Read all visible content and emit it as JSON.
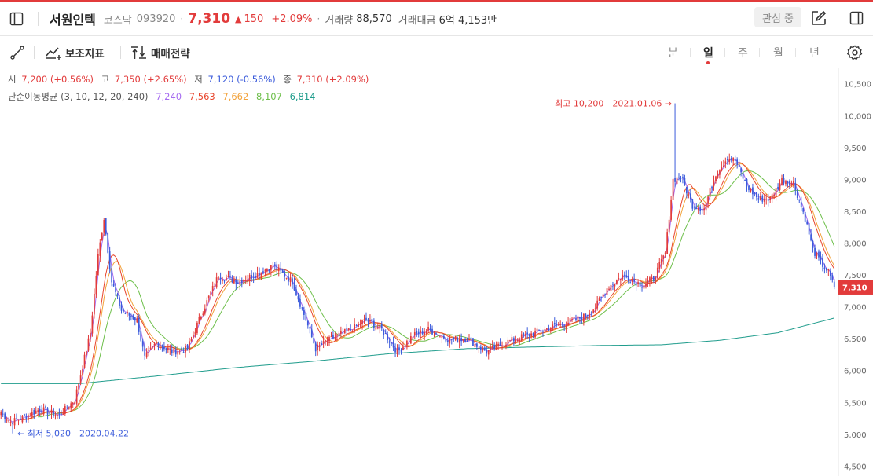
{
  "header": {
    "name": "서원인텍",
    "market": "코스닥",
    "code": "093920",
    "price": "7,310",
    "change_arrow": "▲",
    "change": "150",
    "change_pct": "+2.09%",
    "volume_label": "거래량",
    "volume": "88,570",
    "amount_label": "거래대금",
    "amount": "6억 4,153만",
    "favorite": "관심 중"
  },
  "toolbar": {
    "indicator": "보조지표",
    "strategy": "매매전략",
    "periods": [
      "분",
      "일",
      "주",
      "월",
      "년"
    ],
    "active_period": 1
  },
  "ohlc_bar": {
    "open_label": "시",
    "open": "7,200 (+0.56%)",
    "high_label": "고",
    "high": "7,350 (+2.65%)",
    "low_label": "저",
    "low": "7,120 (-0.56%)",
    "close_label": "종",
    "close": "7,310 (+2.09%)"
  },
  "ma_bar": {
    "label": "단순이동평균 (3, 10, 12, 20, 240)",
    "values": [
      "7,240",
      "7,563",
      "7,662",
      "8,107",
      "6,814"
    ]
  },
  "chart_data": {
    "type": "candlestick",
    "ylim": [
      4400,
      10700
    ],
    "yticks": [
      4500,
      5000,
      5500,
      6000,
      6500,
      7000,
      7500,
      8000,
      8500,
      9000,
      9500,
      10000,
      10500
    ],
    "ytick_labels": [
      "4,500",
      "5,000",
      "5,500",
      "6,000",
      "6,500",
      "7,000",
      "7,500",
      "8,000",
      "8,500",
      "9,000",
      "9,500",
      "10,000",
      "10,500"
    ],
    "last_price": 7310,
    "last_price_label": "7,310",
    "high_annotation": "최고 10,200 - 2021.01.06",
    "high_annotation_arrow": "→",
    "low_annotation_arrow": "←",
    "low_annotation": "최저 5,020 - 2020.04.22",
    "high_value": 10200,
    "low_value": 5020,
    "colors": {
      "up": "#e23b3b",
      "down": "#3b5bdb",
      "ma3": "#a66cf0",
      "ma10": "#e8452c",
      "ma12": "#f2a23a",
      "ma20": "#6dbf4a",
      "ma240": "#1f9c8c"
    },
    "anchors": [
      [
        0,
        5350
      ],
      [
        5,
        5200
      ],
      [
        10,
        5250
      ],
      [
        20,
        5400
      ],
      [
        30,
        5300
      ],
      [
        38,
        5550
      ],
      [
        46,
        6600
      ],
      [
        50,
        7800
      ],
      [
        53,
        8400
      ],
      [
        57,
        7400
      ],
      [
        62,
        6950
      ],
      [
        70,
        6800
      ],
      [
        74,
        6200
      ],
      [
        80,
        6450
      ],
      [
        88,
        6300
      ],
      [
        96,
        6350
      ],
      [
        104,
        6950
      ],
      [
        112,
        7500
      ],
      [
        122,
        7400
      ],
      [
        130,
        7500
      ],
      [
        140,
        7650
      ],
      [
        150,
        7400
      ],
      [
        157,
        6800
      ],
      [
        162,
        6350
      ],
      [
        170,
        6500
      ],
      [
        180,
        6650
      ],
      [
        188,
        6800
      ],
      [
        196,
        6650
      ],
      [
        204,
        6300
      ],
      [
        212,
        6550
      ],
      [
        220,
        6650
      ],
      [
        230,
        6500
      ],
      [
        240,
        6500
      ],
      [
        250,
        6300
      ],
      [
        260,
        6450
      ],
      [
        270,
        6550
      ],
      [
        280,
        6650
      ],
      [
        290,
        6750
      ],
      [
        300,
        6850
      ],
      [
        306,
        7000
      ],
      [
        312,
        7300
      ],
      [
        320,
        7500
      ],
      [
        330,
        7350
      ],
      [
        336,
        7450
      ],
      [
        342,
        7850
      ],
      [
        346,
        9000
      ],
      [
        350,
        9050
      ],
      [
        356,
        8600
      ],
      [
        362,
        8550
      ],
      [
        368,
        9100
      ],
      [
        374,
        9350
      ],
      [
        378,
        9300
      ],
      [
        384,
        8900
      ],
      [
        390,
        8700
      ],
      [
        396,
        8700
      ],
      [
        402,
        9000
      ],
      [
        408,
        8950
      ],
      [
        414,
        8400
      ],
      [
        418,
        7900
      ],
      [
        422,
        7700
      ],
      [
        426,
        7550
      ],
      [
        429,
        7310
      ]
    ],
    "ma240_points": [
      [
        0,
        5800
      ],
      [
        40,
        5800
      ],
      [
        80,
        5920
      ],
      [
        120,
        6050
      ],
      [
        160,
        6150
      ],
      [
        200,
        6270
      ],
      [
        240,
        6350
      ],
      [
        280,
        6380
      ],
      [
        310,
        6400
      ],
      [
        340,
        6410
      ],
      [
        370,
        6480
      ],
      [
        400,
        6600
      ],
      [
        429,
        6830
      ]
    ],
    "candle_count": 430
  }
}
